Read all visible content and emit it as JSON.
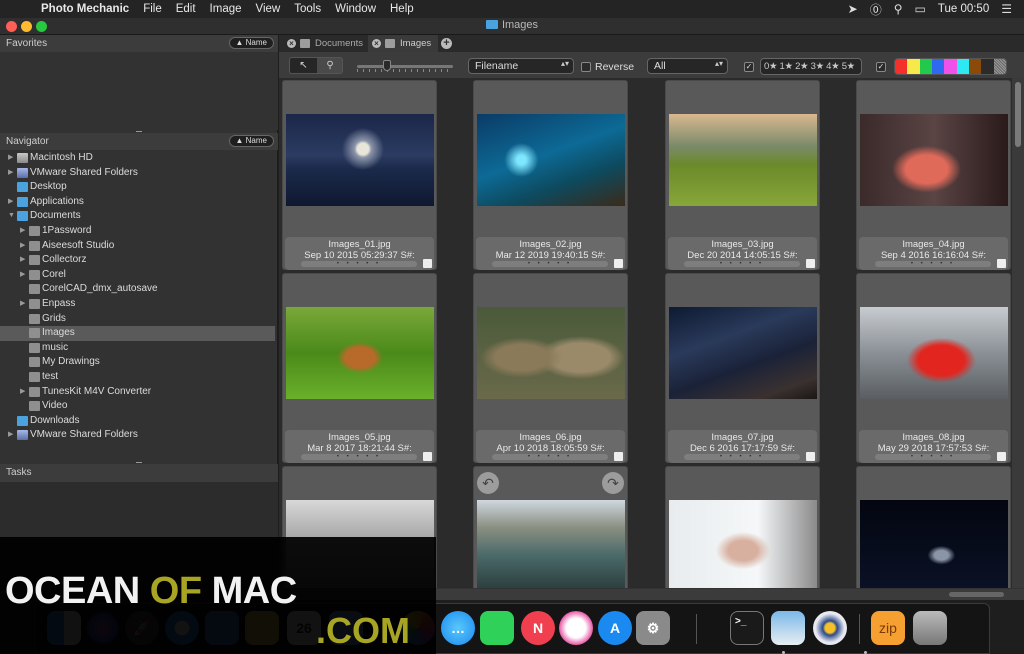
{
  "menubar": {
    "app_name": "Photo Mechanic",
    "items": [
      "File",
      "Edit",
      "Image",
      "View",
      "Tools",
      "Window",
      "Help"
    ],
    "clock": "Tue 00:50",
    "status_icons": [
      "location-icon",
      "1password-icon",
      "spotlight-search-icon",
      "display-mirroring-icon",
      "notification-center-icon"
    ]
  },
  "window": {
    "title": "Images"
  },
  "sidebar": {
    "favorites": {
      "title": "Favorites",
      "sort_label": "▲ Name"
    },
    "navigator": {
      "title": "Navigator",
      "sort_label": "▲ Name",
      "items": [
        {
          "label": "Macintosh HD",
          "level": 0,
          "disclosure": "collapsed",
          "icon": "drive"
        },
        {
          "label": "VMware Shared Folders",
          "level": 0,
          "disclosure": "collapsed",
          "icon": "net"
        },
        {
          "label": "Desktop",
          "level": 0,
          "disclosure": "none",
          "icon": "blue"
        },
        {
          "label": "Applications",
          "level": 0,
          "disclosure": "collapsed",
          "icon": "blue"
        },
        {
          "label": "Documents",
          "level": 0,
          "disclosure": "expanded",
          "icon": "blue"
        },
        {
          "label": "1Password",
          "level": 1,
          "disclosure": "collapsed",
          "icon": "gray"
        },
        {
          "label": "Aiseesoft Studio",
          "level": 1,
          "disclosure": "collapsed",
          "icon": "gray"
        },
        {
          "label": "Collectorz",
          "level": 1,
          "disclosure": "collapsed",
          "icon": "gray"
        },
        {
          "label": "Corel",
          "level": 1,
          "disclosure": "collapsed",
          "icon": "gray"
        },
        {
          "label": "CorelCAD_dmx_autosave",
          "level": 1,
          "disclosure": "none",
          "icon": "gray"
        },
        {
          "label": "Enpass",
          "level": 1,
          "disclosure": "collapsed",
          "icon": "gray"
        },
        {
          "label": "Grids",
          "level": 1,
          "disclosure": "none",
          "icon": "gray"
        },
        {
          "label": "Images",
          "level": 1,
          "disclosure": "none",
          "icon": "gray",
          "selected": true
        },
        {
          "label": "music",
          "level": 1,
          "disclosure": "none",
          "icon": "gray"
        },
        {
          "label": "My Drawings",
          "level": 1,
          "disclosure": "none",
          "icon": "gray"
        },
        {
          "label": "test",
          "level": 1,
          "disclosure": "none",
          "icon": "gray"
        },
        {
          "label": "TunesKit M4V Converter",
          "level": 1,
          "disclosure": "collapsed",
          "icon": "gray"
        },
        {
          "label": "Video",
          "level": 1,
          "disclosure": "none",
          "icon": "gray"
        },
        {
          "label": "Downloads",
          "level": 0,
          "disclosure": "none",
          "icon": "blue"
        },
        {
          "label": "VMware Shared Folders",
          "level": 0,
          "disclosure": "collapsed",
          "icon": "net"
        }
      ]
    },
    "tasks": {
      "title": "Tasks"
    }
  },
  "tabs": [
    {
      "label": "Documents",
      "active": false
    },
    {
      "label": "Images",
      "active": true
    }
  ],
  "toolbar": {
    "tool_select": "↖",
    "tool_zoom": "⚲",
    "thumbnail_size": 0.3,
    "sort_by": "Filename",
    "reverse_label": "Reverse",
    "reverse_checked": false,
    "filter": "All",
    "stars_enabled": true,
    "stars_label": "0★ 1★ 2★ 3★ 4★ 5★",
    "colors_enabled": true,
    "color_classes": [
      "#f5302a",
      "#f8e94a",
      "#22c94a",
      "#2f69f0",
      "#ee52e8",
      "#2ee9f2",
      "#8b4a08",
      "#2b2b2b",
      "#8a8a8a"
    ],
    "dropdown_arrows": "▴▾",
    "check_mark": "✓"
  },
  "thumbnails": [
    {
      "filename": "Images_01.jpg",
      "date": "Sep 10 2015 05:29:37 S#:",
      "scene": "moonlit-sea"
    },
    {
      "filename": "Images_02.jpg",
      "date": "Mar 12 2019 19:40:15 S#:",
      "scene": "underwater"
    },
    {
      "filename": "Images_03.jpg",
      "date": "Dec 20 2014 14:05:15 S#:",
      "scene": "turf-houses"
    },
    {
      "filename": "Images_04.jpg",
      "date": "Sep 4 2016 16:16:04 S#:",
      "scene": "portrait-red"
    },
    {
      "filename": "Images_05.jpg",
      "date": "Mar 8 2017 18:21:44 S#:",
      "scene": "fox-cubs"
    },
    {
      "filename": "Images_06.jpg",
      "date": "Apr 10 2018 18:05:59 S#:",
      "scene": "cats"
    },
    {
      "filename": "Images_07.jpg",
      "date": "Dec 6 2016 17:17:59 S#:",
      "scene": "milky-way"
    },
    {
      "filename": "Images_08.jpg",
      "date": "May 29 2018 17:57:53 S#:",
      "scene": "red-sports-car"
    },
    {
      "filename": "",
      "date": "",
      "scene": "waterfall"
    },
    {
      "filename": "",
      "date": "",
      "scene": "woman-river"
    },
    {
      "filename": "",
      "date": "",
      "scene": "woman-window"
    },
    {
      "filename": "",
      "date": "",
      "scene": "space-ship"
    }
  ],
  "rating_dots": "• • • • •",
  "rotate_left": "↶",
  "rotate_right": "↷",
  "dock": {
    "items": [
      "Finder",
      "Siri",
      "Launchpad",
      "Safari",
      "Mail",
      "Notes",
      "Calendar",
      "Preview",
      "Photos",
      "Messages",
      "FaceTime",
      "News",
      "iTunes",
      "App Store",
      "System Preferences",
      "Terminal",
      "Image Viewer",
      "Photo Mechanic",
      "Archive",
      "Trash"
    ],
    "zip_label": "zip",
    "terminal_label": ">_",
    "calendar_day": "26"
  },
  "watermark": {
    "part1": "OCEAN",
    "part2": "OF",
    "part3": "MAC",
    "suffix": ".COM"
  }
}
